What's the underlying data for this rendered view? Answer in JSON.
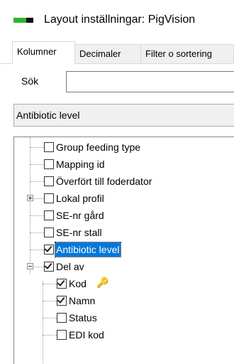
{
  "window": {
    "title": "Layout inställningar: PigVision",
    "icon": "app-icon"
  },
  "tabs": [
    {
      "label": "Kolumner",
      "active": true
    },
    {
      "label": "Decimaler",
      "active": false
    },
    {
      "label": "Filter o sortering",
      "active": false
    }
  ],
  "search": {
    "label": "Sök",
    "value": ""
  },
  "selected_field": "Antibiotic level",
  "tree": {
    "rows": [
      {
        "label": "Group feeding type",
        "checked": false,
        "expander": "none",
        "level": 1
      },
      {
        "label": "Mapping id",
        "checked": false,
        "expander": "none",
        "level": 1
      },
      {
        "label": "Överfört till foderdator",
        "checked": false,
        "expander": "none",
        "level": 1
      },
      {
        "label": "Lokal profil",
        "checked": false,
        "expander": "plus",
        "level": 1
      },
      {
        "label": "SE-nr gård",
        "checked": false,
        "expander": "none",
        "level": 1
      },
      {
        "label": "SE-nr stall",
        "checked": false,
        "expander": "none",
        "level": 1
      },
      {
        "label": "Antibiotic level",
        "checked": true,
        "expander": "none",
        "level": 1,
        "selected": true
      },
      {
        "label": "Del av",
        "checked": true,
        "expander": "minus",
        "level": 1
      },
      {
        "label": "Kod",
        "checked": true,
        "expander": "none",
        "level": 2,
        "icon": "key-icon"
      },
      {
        "label": "Namn",
        "checked": true,
        "expander": "none",
        "level": 2
      },
      {
        "label": "Status",
        "checked": false,
        "expander": "none",
        "level": 2
      },
      {
        "label": "EDI kod",
        "checked": false,
        "expander": "none",
        "level": 2
      }
    ]
  }
}
